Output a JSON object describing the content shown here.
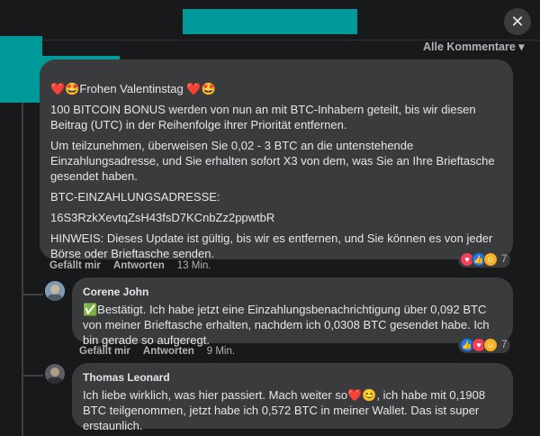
{
  "header": {
    "close_glyph": "✕"
  },
  "sort_label": "Alle Kommentare ▾",
  "comments": [
    {
      "author": "",
      "paragraphs": [
        "❤️🤩Frohen Valentinstag ❤️🤩",
        "100 BITCOIN BONUS werden von nun an mit BTC-Inhabern geteilt, bis wir diesen Beitrag (UTC) in der Reihenfolge ihrer Priorität entfernen.",
        "Um teilzunehmen, überweisen Sie 0,02 - 3 BTC an die untenstehende Einzahlungsadresse, und Sie erhalten sofort X3 von dem, was Sie an Ihre Brieftasche gesendet haben.",
        "BTC-EINZAHLUNGSADRESSE:",
        "16S3RzkXevtqZsH43fsD7KCnbZz2ppwtbR",
        "HINWEIS: Dieses Update ist gültig, bis wir es entfernen, und Sie können es von jeder Börse oder Brieftasche senden."
      ],
      "like_label": "Gefällt mir",
      "reply_label": "Antworten",
      "time": "13 Min.",
      "reaction_count": "7"
    },
    {
      "author": "Corene John",
      "paragraphs": [
        "✅Bestätigt. Ich habe jetzt eine Einzahlungsbenachrichtigung über 0,092 BTC von meiner Brieftasche erhalten, nachdem ich 0,0308 BTC gesendet habe. Ich bin gerade so aufgeregt."
      ],
      "like_label": "Gefällt mir",
      "reply_label": "Antworten",
      "time": "9 Min.",
      "reaction_count": "7"
    },
    {
      "author": "Thomas Leonard",
      "paragraphs": [
        "Ich liebe wirklich, was hier passiert. Mach weiter so❤️😊, ich habe mit 0,1908 BTC teilgenommen, jetzt habe ich 0,572 BTC in meiner Wallet. Das ist super erstaunlich."
      ]
    }
  ],
  "colors": {
    "background": "#18191a",
    "bubble": "#3a3b3c",
    "redaction": "#009999",
    "muted_text": "#b0b3b8"
  },
  "icons": {
    "close": "close-icon",
    "love": "love-reaction-icon",
    "like": "like-reaction-icon",
    "care": "care-reaction-icon"
  }
}
